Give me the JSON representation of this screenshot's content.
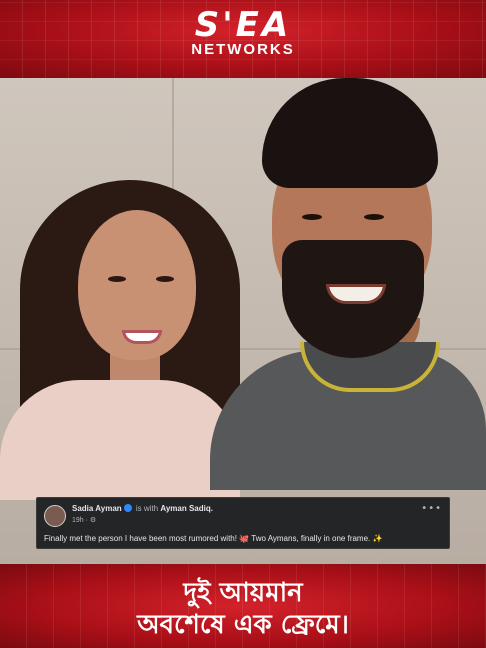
{
  "brand": {
    "logo_main": "S'EA",
    "logo_sub": "NETWORKS"
  },
  "post": {
    "author": "Sadia Ayman",
    "with_text": "is with",
    "tagged": "Ayman Sadiq.",
    "time": "19h · ⚙",
    "more": "•••",
    "body": "Finally met the person I have been most rumored with! 🐙 Two Aymans, finally in one frame. ✨"
  },
  "headline": {
    "line1": "দুই আয়মান",
    "line2": "অবশেষে এক ফ্রেমে।"
  },
  "colors": {
    "banner_red": "#b3141c",
    "card_bg": "#242526",
    "verified_blue": "#2d88ff"
  }
}
